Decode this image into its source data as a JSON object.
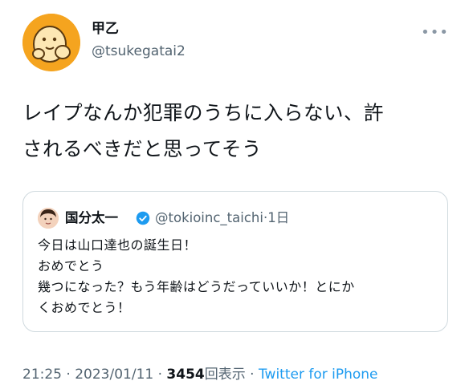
{
  "author": {
    "display_name": "甲乙",
    "handle": "@tsukegatai2"
  },
  "more_menu": "•••",
  "tweet": {
    "lines": [
      "レイプなんか犯罪のうちに入らない、許",
      "されるべきだと思ってそう"
    ]
  },
  "quoted_tweet": {
    "display_name": "国分太一",
    "handle": "@tokioinc_taichi",
    "time": "1日",
    "separator": "·",
    "lines": [
      "今日は山口達也の誕生日！",
      "おめでとう",
      "幾つになった？もう年齢はどうだっていいか！とにか",
      "くおめでとう！"
    ]
  },
  "meta": {
    "time": "21:25",
    "date": "2023/01/11",
    "views_count": "3454",
    "views_label": "回表示",
    "source": "Twitter for iPhone",
    "separator": "·"
  },
  "colors": {
    "avatar_bg": "#f5a41f",
    "link_blue": "#1d9bf0",
    "secondary_text": "#536471",
    "verified": "#1d9bf0"
  }
}
